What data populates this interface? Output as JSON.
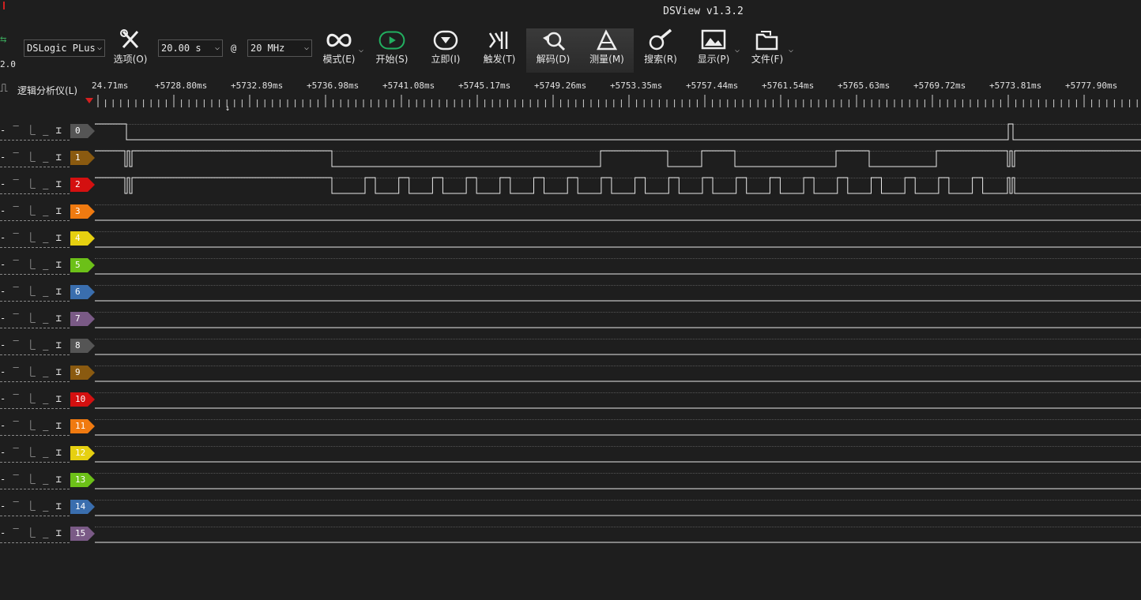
{
  "app": {
    "title": "DSView v1.3.2"
  },
  "toolbar": {
    "usb_version": "2.0",
    "device": "DSLogic PLus",
    "duration": "20.00 s",
    "at": "@",
    "rate": "20 MHz",
    "options_label": "选项(O)",
    "mode_label": "模式(E)",
    "start_label": "开始(S)",
    "instant_label": "立即(I)",
    "trigger_label": "触发(T)",
    "decode_label": "解码(D)",
    "measure_label": "测量(M)",
    "search_label": "搜索(R)",
    "display_label": "显示(P)",
    "file_label": "文件(F)"
  },
  "ruler": {
    "label": "逻辑分析仪(L)",
    "ticks": [
      "24.71ms",
      "+5728.80ms",
      "+5732.89ms",
      "+5736.98ms",
      "+5741.08ms",
      "+5745.17ms",
      "+5749.26ms",
      "+5753.35ms",
      "+5757.44ms",
      "+5761.54ms",
      "+5765.63ms",
      "+5769.72ms",
      "+5773.81ms",
      "+5777.90ms"
    ]
  },
  "channels": [
    {
      "id": "0",
      "color": "#555555"
    },
    {
      "id": "1",
      "color": "#8a5a10"
    },
    {
      "id": "2",
      "color": "#d41010"
    },
    {
      "id": "3",
      "color": "#f07a10"
    },
    {
      "id": "4",
      "color": "#e6d010"
    },
    {
      "id": "5",
      "color": "#6cc018"
    },
    {
      "id": "6",
      "color": "#3a6eae"
    },
    {
      "id": "7",
      "color": "#7a5a86"
    },
    {
      "id": "8",
      "color": "#555555"
    },
    {
      "id": "9",
      "color": "#8a5a10"
    },
    {
      "id": "10",
      "color": "#d41010"
    },
    {
      "id": "11",
      "color": "#f07a10"
    },
    {
      "id": "12",
      "color": "#e6d010"
    },
    {
      "id": "13",
      "color": "#6cc018"
    },
    {
      "id": "14",
      "color": "#3a6eae"
    },
    {
      "id": "15",
      "color": "#7a5a86"
    }
  ],
  "trigger_icons": "‐ ‾ ⎿ _ ⌶"
}
